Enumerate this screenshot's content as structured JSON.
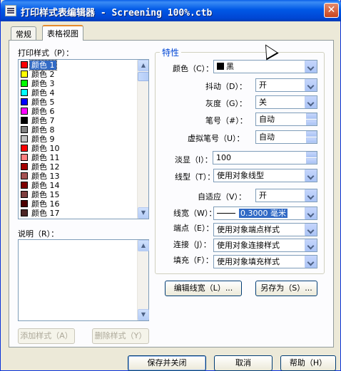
{
  "window": {
    "title": "打印样式表编辑器 - Screening 100%.ctb",
    "close_glyph": "✕"
  },
  "tabs": [
    {
      "label": "常规"
    },
    {
      "label": "表格视图"
    }
  ],
  "left": {
    "styles_label": "打印样式（P）：",
    "items": [
      {
        "label": "颜色 1",
        "color": "#ff0000"
      },
      {
        "label": "颜色 2",
        "color": "#ffff00"
      },
      {
        "label": "颜色 3",
        "color": "#00ff00"
      },
      {
        "label": "颜色 4",
        "color": "#00ffff"
      },
      {
        "label": "颜色 5",
        "color": "#0000ff"
      },
      {
        "label": "颜色 6",
        "color": "#ff00ff"
      },
      {
        "label": "颜色 7",
        "color": "#000000"
      },
      {
        "label": "颜色 8",
        "color": "#808080"
      },
      {
        "label": "颜色 9",
        "color": "#c0c0c0"
      },
      {
        "label": "颜色 10",
        "color": "#ff0000"
      },
      {
        "label": "颜色 11",
        "color": "#ff7f7f"
      },
      {
        "label": "颜色 12",
        "color": "#a50000"
      },
      {
        "label": "颜色 13",
        "color": "#a55252"
      },
      {
        "label": "颜色 14",
        "color": "#7f0000"
      },
      {
        "label": "颜色 15",
        "color": "#7f3f3f"
      },
      {
        "label": "颜色 16",
        "color": "#4c0000"
      },
      {
        "label": "颜色 17",
        "color": "#4c2626"
      }
    ],
    "desc_label": "说明（R）：",
    "add_button": "添加样式（A）",
    "delete_button": "删除样式（Y）"
  },
  "props": {
    "group_title": "特性",
    "color_label": "颜色（C）：",
    "color_value": "黑",
    "dither_label": "抖动（D）：",
    "dither_value": "开",
    "grayscale_label": "灰度（G）：",
    "grayscale_value": "关",
    "pen_label": "笔号（#）：",
    "pen_value": "自动",
    "vpen_label": "虚拟笔号（U）：",
    "vpen_value": "自动",
    "screening_label": "淡显（I）：",
    "screening_value": "100",
    "linetype_label": "线型（T）：",
    "linetype_value": "使用对象线型",
    "adaptive_label": "自适应（V）：",
    "adaptive_value": "开",
    "lineweight_label": "线宽（W）：",
    "lineweight_value": "0.3000 毫米",
    "endstyle_label": "端点（E）：",
    "endstyle_value": "使用对象端点样式",
    "joinstyle_label": "连接（J）：",
    "joinstyle_value": "使用对象连接样式",
    "fillstyle_label": "填充（F）：",
    "fillstyle_value": "使用对象填充样式",
    "edit_lineweights": "编辑线宽（L）...",
    "save_as": "另存为（S）..."
  },
  "footer": {
    "save_close": "保存并关闭",
    "cancel": "取消",
    "help": "帮助（H）"
  }
}
